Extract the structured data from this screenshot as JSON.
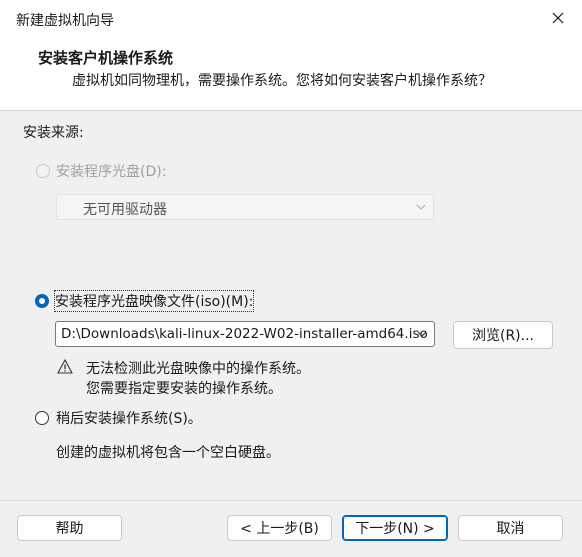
{
  "window": {
    "title": "新建虚拟机向导"
  },
  "header": {
    "title": "安装客户机操作系统",
    "subtitle": "虚拟机如同物理机，需要操作系统。您将如何安装客户机操作系统？"
  },
  "source": {
    "label": "安装来源:",
    "disc_option": {
      "label": "安装程序光盘(D):",
      "selected": false,
      "enabled": false
    },
    "disc_drive": {
      "value": "无可用驱动器",
      "enabled": false
    },
    "iso_option": {
      "label": "安装程序光盘映像文件(iso)(M):",
      "selected": true,
      "enabled": true
    },
    "iso_path": {
      "value": "D:\\Downloads\\kali-linux-2022-W02-installer-amd64.iso"
    },
    "browse_label": "浏览(R)...",
    "warning": {
      "icon": "warning-triangle-icon",
      "line1": "无法检测此光盘映像中的操作系统。",
      "line2": "您需要指定要安装的操作系统。"
    },
    "later_option": {
      "label": "稍后安装操作系统(S)。",
      "selected": false,
      "enabled": true
    },
    "later_description": "创建的虚拟机将包含一个空白硬盘。"
  },
  "footer": {
    "help_label": "帮助",
    "back_label": "< 上一步(B)",
    "next_label": "下一步(N) >",
    "cancel_label": "取消"
  },
  "colors": {
    "accent": "#0067c0",
    "background": "#f0f0f0",
    "header_bg": "#ffffff",
    "disabled_text": "#a0a0a0"
  }
}
